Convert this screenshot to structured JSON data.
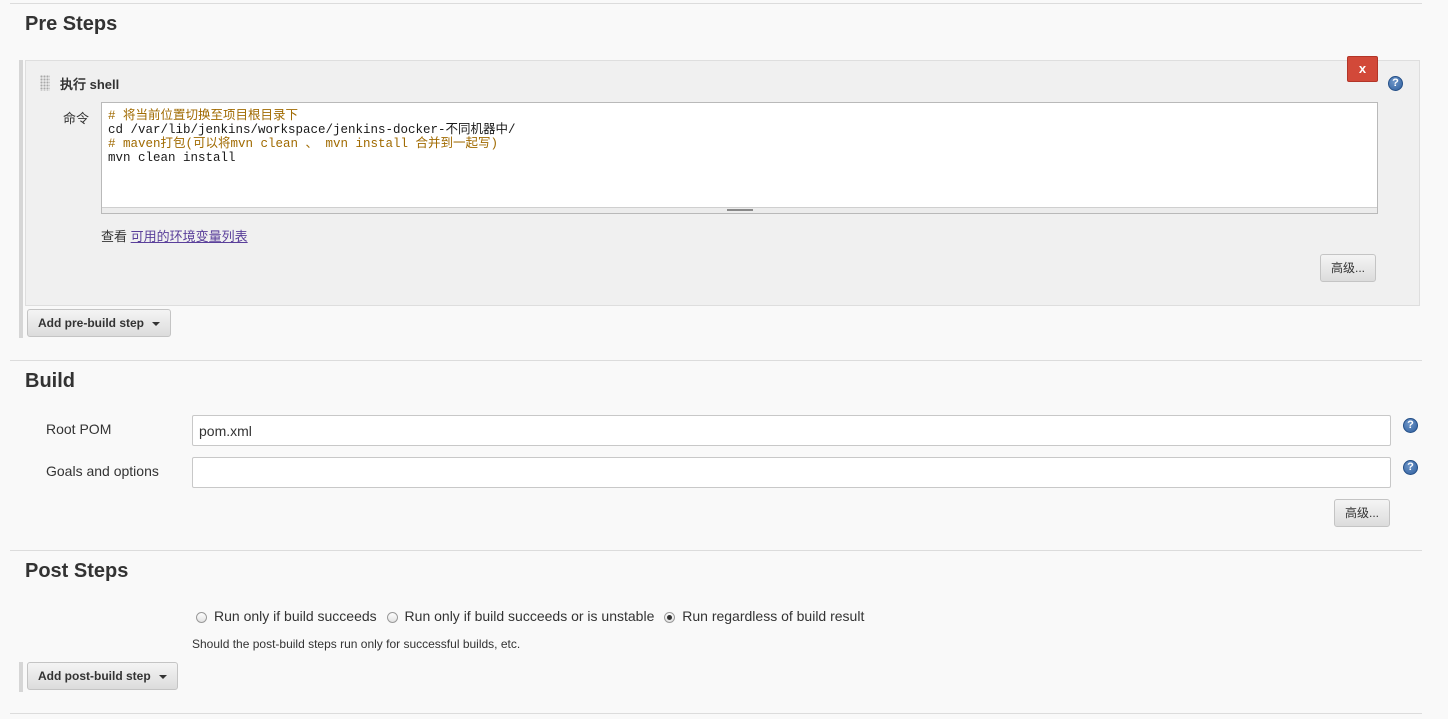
{
  "pre_steps": {
    "title": "Pre Steps",
    "shell_step": {
      "title": "执行 shell",
      "close_label": "x",
      "command_label": "命令",
      "command_lines": [
        "# 将当前位置切换至项目根目录下",
        "cd /var/lib/jenkins/workspace/jenkins-docker-不同机器中/",
        "# maven打包(可以将mvn clean 、 mvn install 合并到一起写)",
        "mvn clean install"
      ],
      "env_prefix": "查看",
      "env_link": "可用的环境变量列表",
      "advanced_label": "高级..."
    },
    "add_button": "Add pre-build step"
  },
  "build": {
    "title": "Build",
    "root_pom_label": "Root POM",
    "root_pom_value": "pom.xml",
    "goals_label": "Goals and options",
    "goals_value": "",
    "advanced_label": "高级..."
  },
  "post_steps": {
    "title": "Post Steps",
    "options": [
      {
        "label": "Run only if build succeeds",
        "checked": false
      },
      {
        "label": "Run only if build succeeds or is unstable",
        "checked": false
      },
      {
        "label": "Run regardless of build result",
        "checked": true
      }
    ],
    "hint": "Should the post-build steps run only for successful builds, etc.",
    "add_button": "Add post-build step"
  },
  "icons": {
    "help": "help-icon",
    "close": "close-icon",
    "drag": "drag-handle-icon",
    "dropdown": "caret-down-icon"
  },
  "colors": {
    "close_button": "#d24939",
    "help_icon": "#2f5f9e",
    "link": "#5a3f9a",
    "comment": "#a06a00"
  }
}
